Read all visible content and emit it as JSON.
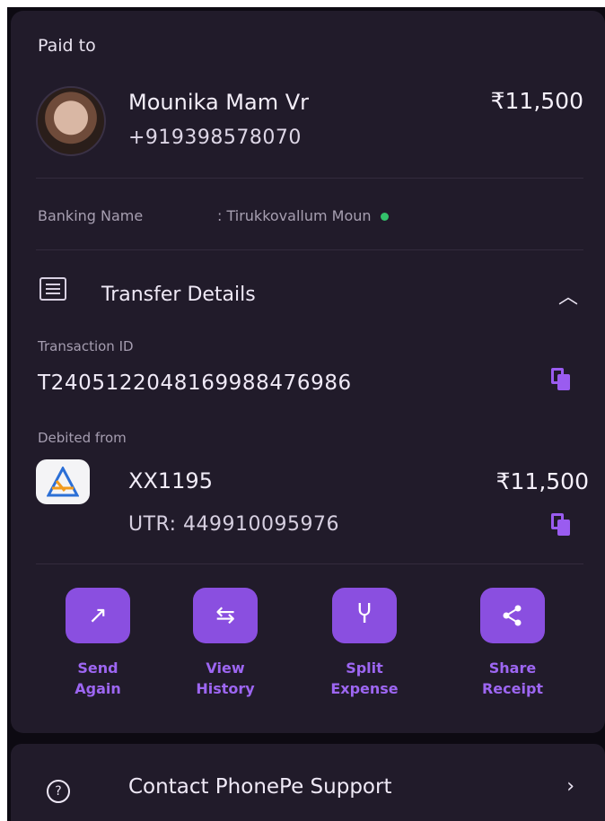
{
  "header": {
    "paid_to_label": "Paid to"
  },
  "payee": {
    "name": "Mounika Mam Vr",
    "phone": "+919398578070",
    "amount": "₹11,500",
    "banking_label": "Banking Name",
    "banking_value": ": Tirukkovallum Moun"
  },
  "transfer": {
    "title": "Transfer Details",
    "transaction_label": "Transaction ID",
    "transaction_id": "T2405122048169988476986",
    "debited_label": "Debited from",
    "account": "XX1195",
    "amount": "₹11,500",
    "utr": "UTR: 449910095976"
  },
  "actions": [
    {
      "label": "Send\nAgain",
      "icon": "arrow-up-right-icon"
    },
    {
      "label": "View\nHistory",
      "icon": "swap-icon"
    },
    {
      "label": "Split\nExpense",
      "icon": "split-icon"
    },
    {
      "label": "Share\nReceipt",
      "icon": "share-icon"
    }
  ],
  "support": {
    "label": "Contact PhonePe Support"
  },
  "colors": {
    "background": "#0d0a12",
    "card": "#211b2a",
    "accent": "#8a4fe0",
    "accent_text": "#9d66f2",
    "verified": "#33c16b"
  }
}
